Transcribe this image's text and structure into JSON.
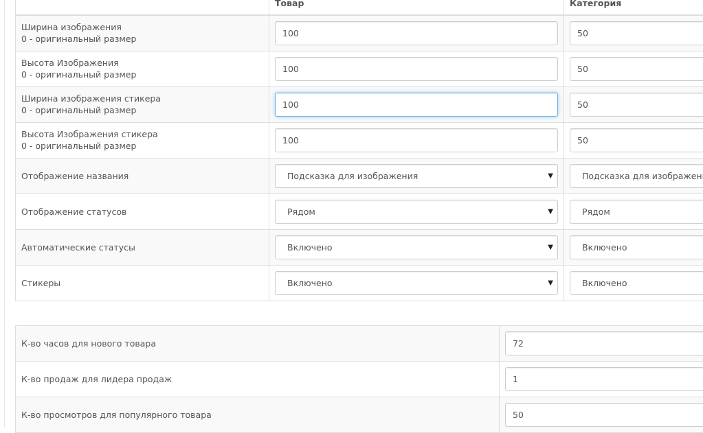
{
  "headers": {
    "col_product": "Товар",
    "col_category": "Категория"
  },
  "rows": [
    {
      "label1": "Ширина изображения",
      "label2": "0 - оригинальный размер",
      "product": "100",
      "category": "50"
    },
    {
      "label1": "Высота Изображения",
      "label2": "0 - оригинальный размер",
      "product": "100",
      "category": "50"
    },
    {
      "label1": "Ширина изображения стикера",
      "label2": "0 - оригинальный размер",
      "product": "100",
      "category": "50"
    },
    {
      "label1": "Высота Изображения стикера",
      "label2": "0 - оригинальный размер",
      "product": "100",
      "category": "50"
    },
    {
      "label1": "Отображение названия",
      "product": "Подсказка для изображения",
      "category": "Подсказка для изображения"
    },
    {
      "label1": "Отображение статусов",
      "product": "Рядом",
      "category": "Рядом"
    },
    {
      "label1": "Автоматические статусы",
      "product": "Включено",
      "category": "Включено"
    },
    {
      "label1": "Стикеры",
      "product": "Включено",
      "category": "Включено"
    }
  ],
  "settings": [
    {
      "label": "К-во часов для нового товара",
      "value": "72"
    },
    {
      "label": "К-во продаж для лидера продаж",
      "value": "1"
    },
    {
      "label": "К-во просмотров для популярного товара",
      "value": "50"
    }
  ],
  "icons": {
    "dropdown": "caret-down-icon"
  }
}
